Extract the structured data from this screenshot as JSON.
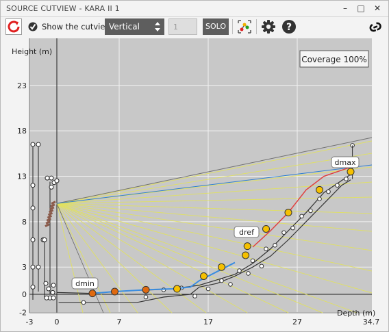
{
  "window": {
    "title": "SOURCE CUTVIEW - KARA II 1",
    "minimize_icon": "–",
    "maximize_icon": "□",
    "close_icon": "✕"
  },
  "toolbar": {
    "show_cutview_label": "Show the cutview",
    "show_cutview_checked": true,
    "view_select_value": "Vertical",
    "number_value": "1",
    "solo_label": "SOLO",
    "icons": [
      "refresh-icon",
      "checkmark-icon",
      "updown-arrows-icon",
      "layout-nodes-icon",
      "gear-icon",
      "help-icon",
      "link-icon"
    ]
  },
  "plot": {
    "coverage_label": "Coverage 100%",
    "y_axis_label": "Height (m)",
    "x_axis_label": "Depth (m)",
    "y_ticks": [
      "23",
      "18",
      "13",
      "8",
      "3",
      "0",
      "-2"
    ],
    "x_ticks": [
      "-3",
      "0",
      "7",
      "17",
      "27",
      "34.7"
    ],
    "annotations": {
      "dmin": "dmin",
      "dref": "dref",
      "dmax": "dmax"
    },
    "colors": {
      "background": "#c8c8c8",
      "ray": "#e3e35a",
      "coverage_line": "#2f7fd0",
      "top_line": "#707070",
      "blue_segment": "#3a8de0",
      "red_segment": "#e04040",
      "orange": "#e06a10",
      "yellow": "#f5c000"
    }
  }
}
